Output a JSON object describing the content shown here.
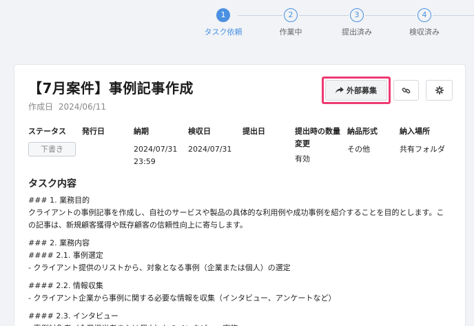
{
  "stepper": {
    "steps": [
      {
        "num": "1",
        "label": "タスク依頼"
      },
      {
        "num": "2",
        "label": "作業中"
      },
      {
        "num": "3",
        "label": "提出済み"
      },
      {
        "num": "4",
        "label": "検収済み"
      }
    ],
    "active_step": 1
  },
  "task": {
    "title": "【7月案件】事例記事作成",
    "created_label": "作成日",
    "created_date": "2024/06/11"
  },
  "actions": {
    "external_label": "外部募集",
    "link_icon": "link-icon",
    "gear_icon": "gear-icon"
  },
  "info": {
    "status": {
      "header": "ステータス",
      "value": "下書き"
    },
    "issue_date": {
      "header": "発行日",
      "value": ""
    },
    "deadline": {
      "header": "納期",
      "value_date": "2024/07/31",
      "value_time": "23:59"
    },
    "inspection_date": {
      "header": "検収日",
      "value": "2024/07/31"
    },
    "submission_date": {
      "header": "提出日",
      "value": ""
    },
    "quantity_change": {
      "header_line1": "提出時の数量",
      "header_line2": "変更",
      "value": "有効"
    },
    "deliverable_format": {
      "header": "納品形式",
      "value": "その他"
    },
    "delivery_location": {
      "header": "納入場所",
      "value": "共有フォルダ"
    }
  },
  "content": {
    "heading": "タスク内容",
    "lines": [
      "### 1. 業務目的",
      "クライアントの事例記事を作成し、自社のサービスや製品の具体的な利用例や成功事例を紹介することを目的とします。こ",
      "の記事は、新規顧客獲得や既存顧客の信頼性向上に寄与します。",
      "",
      "### 2. 業務内容",
      "#### 2.1. 事例選定",
      "- クライアント提供のリストから、対象となる事例（企業または個人）の選定",
      "",
      "#### 2.2. 情報収集",
      "- クライアント企業から事例に関する必要な情報を収集（インタビュー、アンケートなど）",
      "",
      "#### 2.3. インタビュー",
      "- 事例対象者（企業担当者または個人）とのインタビュー実施"
    ]
  },
  "colors": {
    "accent": "#4a90e2",
    "highlight": "#ee3a72",
    "background": "#f1f3f6"
  }
}
